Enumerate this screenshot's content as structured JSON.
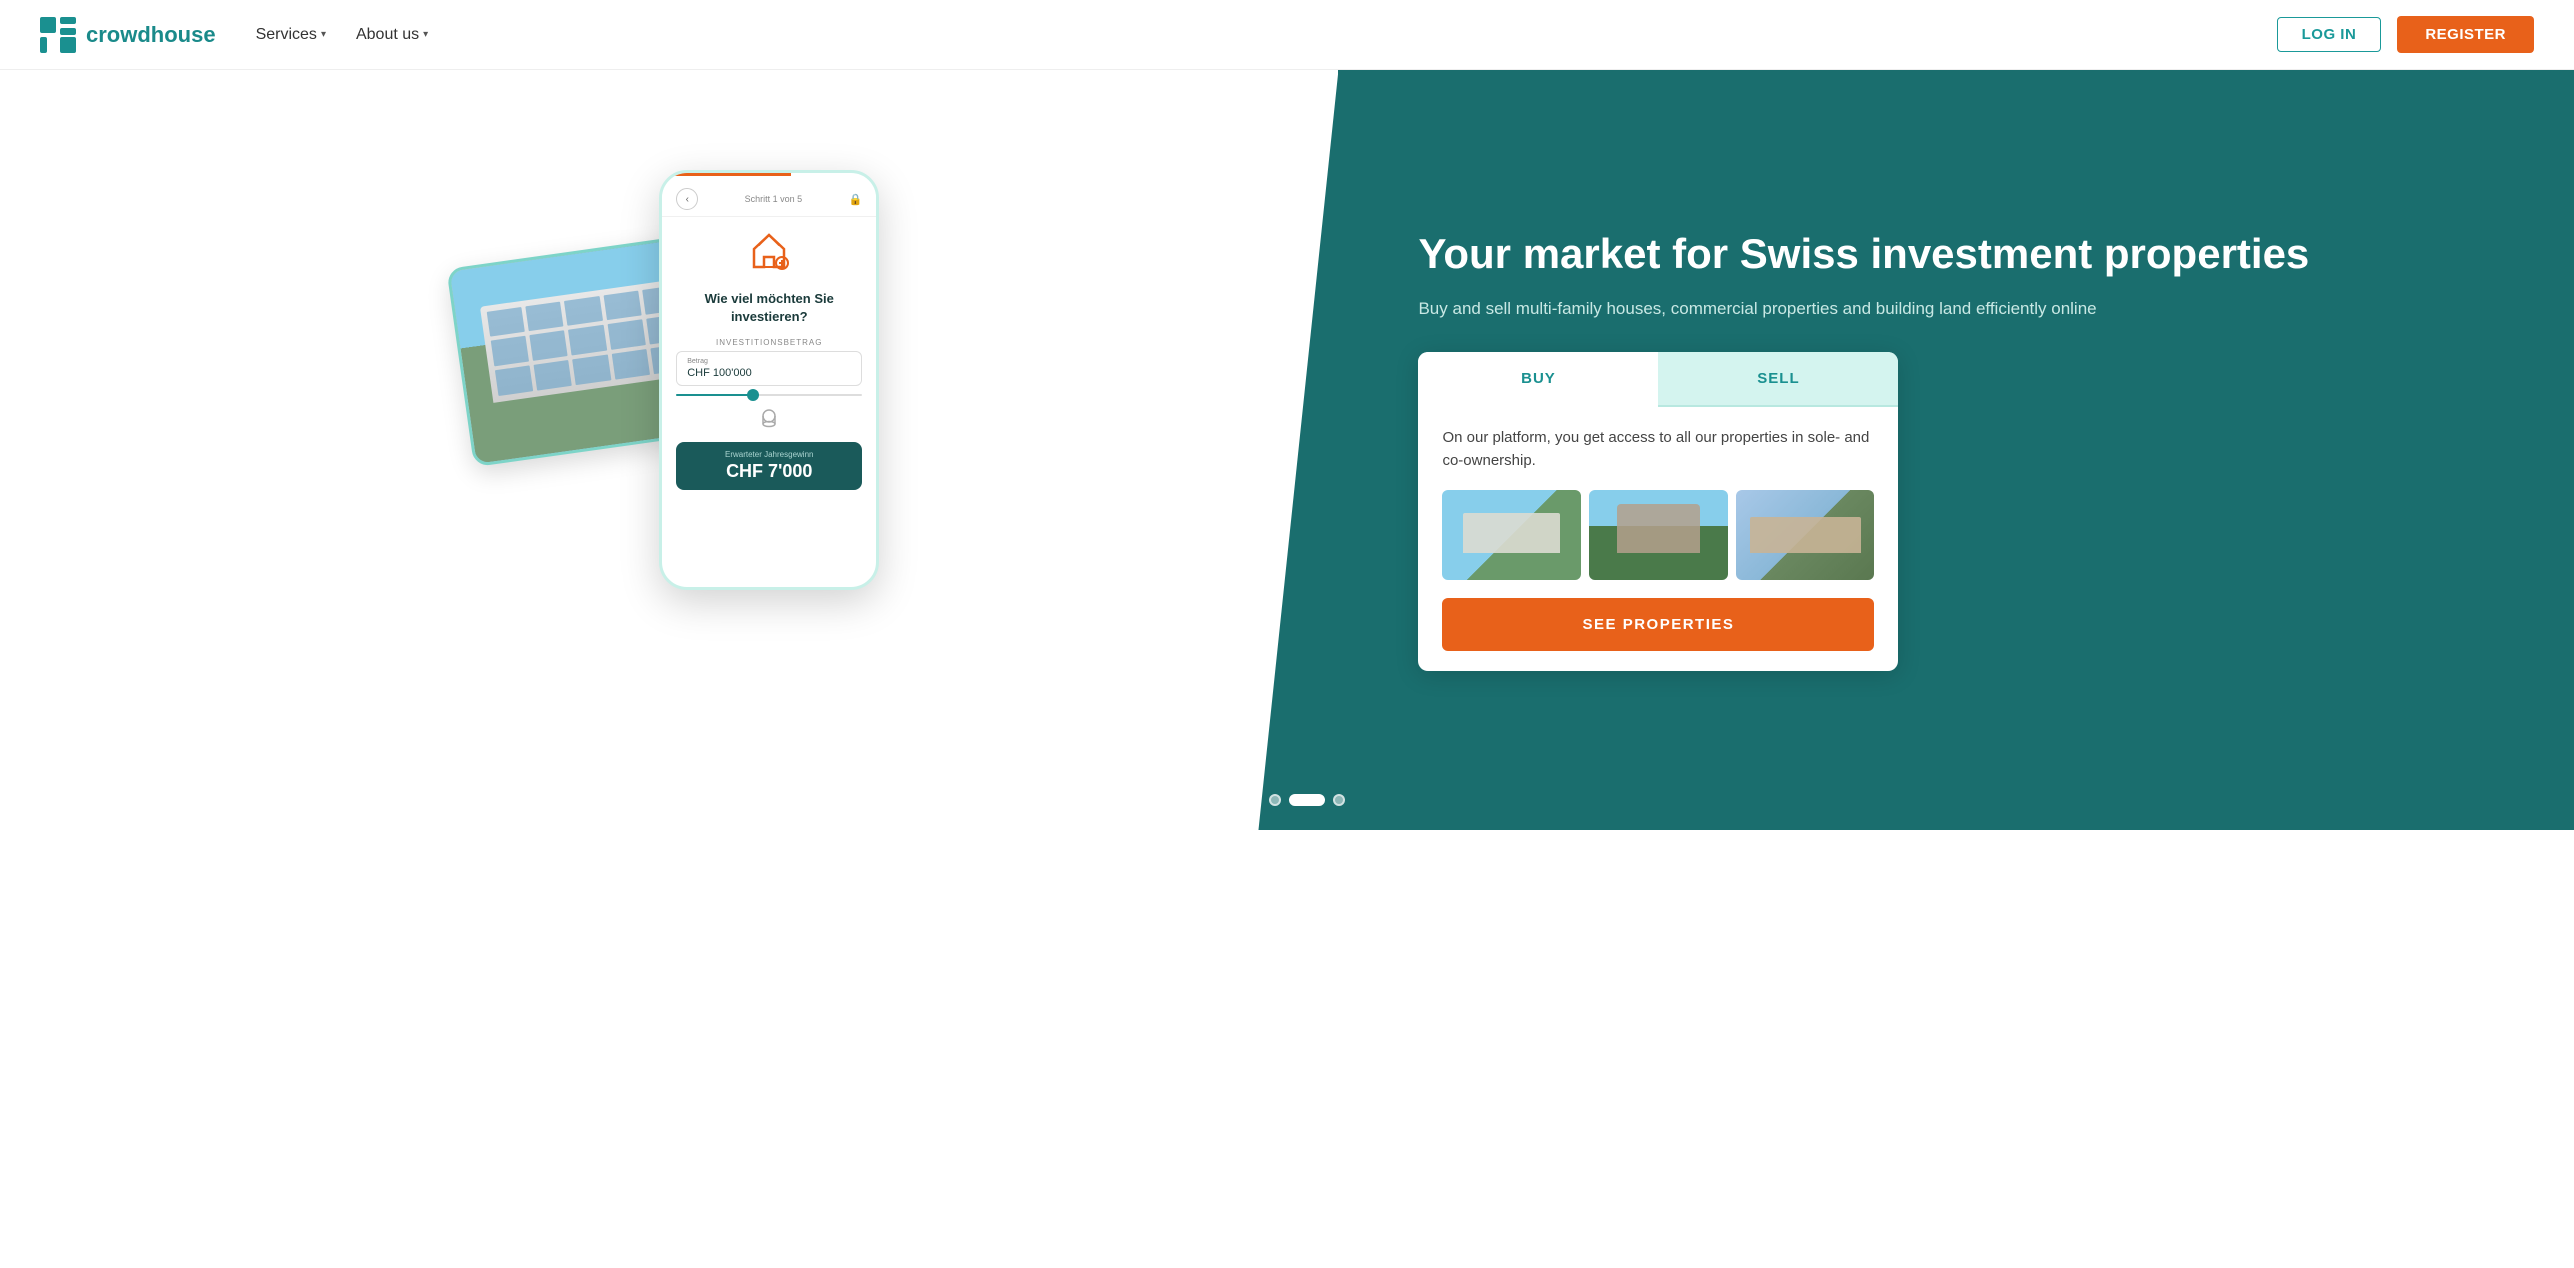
{
  "brand": {
    "name": "crowdhouse",
    "logo_alt": "crowdhouse logo"
  },
  "navbar": {
    "services_label": "Services",
    "about_label": "About us",
    "login_label": "LOG IN",
    "register_label": "REGISTER"
  },
  "hero": {
    "title": "Your market for Swiss investment properties",
    "subtitle": "Buy and sell multi-family houses, commercial properties and building land efficiently online",
    "tab_buy": "BUY",
    "tab_sell": "SELL",
    "card_description": "On our platform, you get access to all our properties in sole- and co-ownership.",
    "see_properties_btn": "SEE PROPERTIES"
  },
  "phone": {
    "step_label": "Schritt 1 von 5",
    "question": "Wie viel möchten Sie investieren?",
    "investment_label": "INVESTITIONSBETRAG",
    "betrag_label": "Betrag",
    "betrag_value": "CHF 100'000",
    "coin_label": "",
    "result_label": "Erwarteter Jahresgewinn",
    "result_value": "CHF 7'000"
  },
  "dots": {
    "items": [
      "dot",
      "dot",
      "dot",
      "dot-active",
      "dot"
    ]
  }
}
